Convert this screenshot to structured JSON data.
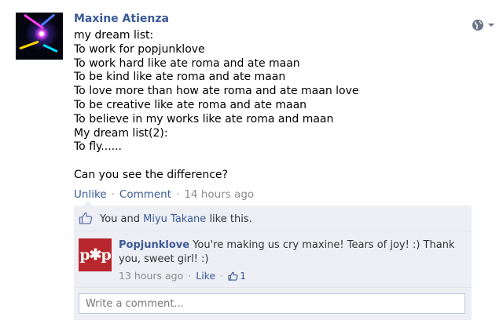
{
  "post": {
    "author": "Maxine Atienza",
    "lines": [
      "my dream list:",
      "To work for popjunklove",
      "To work hard like ate roma and ate maan",
      "To be kind like ate roma and ate maan",
      "To love more than how ate roma and ate maan love",
      "To be creative like ate roma and ate maan",
      "To believe in my works like ate roma and maan",
      "My dream list(2):",
      "To fly......",
      "",
      "Can you see the difference?"
    ],
    "privacy_icon": "globe-icon"
  },
  "actions": {
    "unlike": "Unlike",
    "comment": "Comment",
    "time": "14 hours ago",
    "separator": "·"
  },
  "likes": {
    "you": "You and",
    "other": "Miyu Takane",
    "suffix": "like this."
  },
  "comment": {
    "logo_text": "p✱p",
    "author": "Popjunklove",
    "text": "You're making us cry maxine! Tears of joy! :) Thank you, sweet girl! :)",
    "time": "13 hours ago",
    "like_label": "Like",
    "like_count": "1"
  },
  "write_comment": {
    "placeholder": "Write a comment..."
  },
  "colors": {
    "link": "#3b5998",
    "ufi_background": "#edeff4",
    "logo_red": "#b7272d"
  }
}
